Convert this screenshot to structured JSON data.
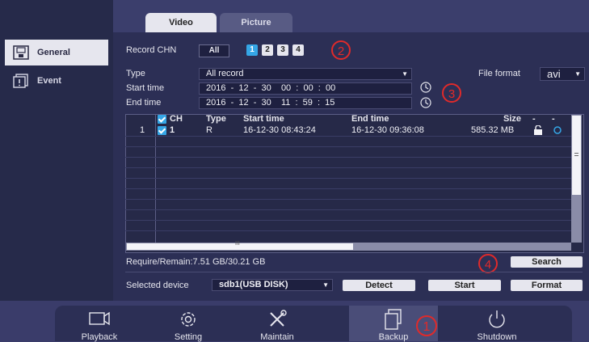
{
  "sidebar": {
    "items": [
      {
        "label": "General",
        "icon": "disk-icon",
        "active": true
      },
      {
        "label": "Event",
        "icon": "document-alert-icon",
        "active": false
      }
    ]
  },
  "tabs": [
    {
      "label": "Video",
      "active": true
    },
    {
      "label": "Picture",
      "active": false
    }
  ],
  "record_chn": {
    "label": "Record CHN",
    "all_label": "All",
    "channels": [
      "1",
      "2",
      "3",
      "4"
    ],
    "selected": "1"
  },
  "type": {
    "label": "Type",
    "value": "All record"
  },
  "file_format": {
    "label": "File format",
    "value": "avi"
  },
  "start_time": {
    "label": "Start time",
    "value": "2016  -  12  -  30    00  :  00  :  00"
  },
  "end_time": {
    "label": "End time",
    "value": "2016  -  12  -  30    11  :  59  :  15"
  },
  "table": {
    "columns": [
      "CH",
      "Type",
      "Start time",
      "End time",
      "Size",
      "-",
      "-"
    ],
    "rows": [
      {
        "index": "1",
        "ch": "1",
        "type": "R",
        "start": "16-12-30 08:43:24",
        "end": "16-12-30 09:36:08",
        "size": "585.32 MB"
      }
    ],
    "hscroll_marker": "III"
  },
  "require_remain": "Require/Remain:7.51 GB/30.21 GB",
  "search_label": "Search",
  "selected_device": {
    "label": "Selected device",
    "value": "sdb1(USB DISK)"
  },
  "detect_label": "Detect",
  "start_label": "Start",
  "format_label": "Format",
  "annotations": [
    "1",
    "2",
    "3",
    "4"
  ],
  "dock": [
    {
      "label": "Playback",
      "icon": "camera-icon"
    },
    {
      "label": "Setting",
      "icon": "gear-icon"
    },
    {
      "label": "Maintain",
      "icon": "tools-icon"
    },
    {
      "label": "Backup",
      "icon": "backup-icon",
      "active": true
    },
    {
      "label": "Shutdown",
      "icon": "power-icon"
    }
  ],
  "colors": {
    "accent": "#35a6e6",
    "annotation": "#e02a2a",
    "background": "#3a3c6a"
  }
}
